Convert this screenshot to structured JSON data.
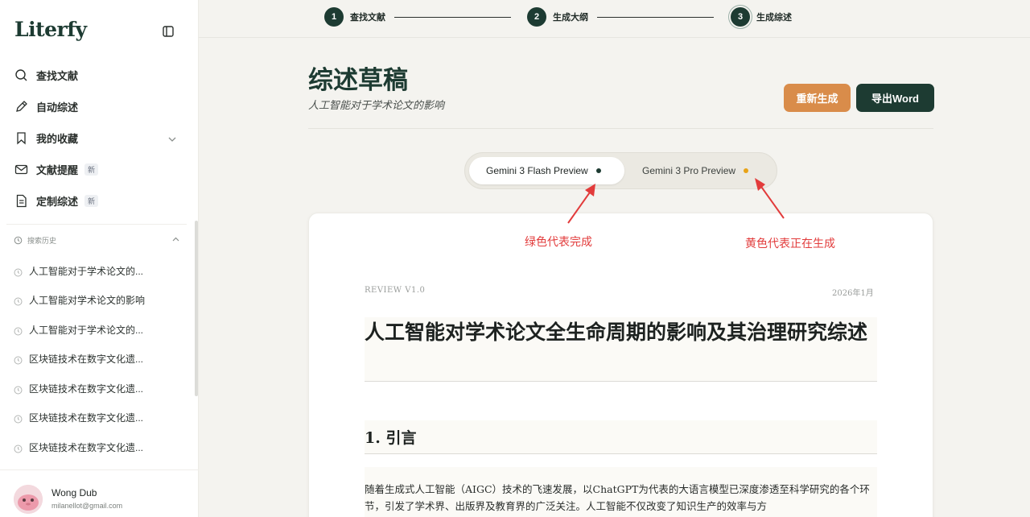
{
  "brand": "Literfy",
  "sidebar": {
    "nav": [
      {
        "label": "查找文献",
        "icon": "search-icon"
      },
      {
        "label": "自动综述",
        "icon": "pen-icon"
      },
      {
        "label": "我的收藏",
        "icon": "bookmark-icon"
      },
      {
        "label": "文献提醒",
        "icon": "mail-icon",
        "badge": "新"
      },
      {
        "label": "定制综述",
        "icon": "document-icon",
        "badge": "新"
      }
    ],
    "history_title": "搜索历史",
    "history": [
      "人工智能对于学术论文的...",
      "人工智能对学术论文的影响",
      "人工智能对于学术论文的...",
      "区块链技术在数字文化遗...",
      "区块链技术在数字文化遗...",
      "区块链技术在数字文化遗...",
      "区块链技术在数字文化遗..."
    ],
    "user": {
      "name": "Wong Dub",
      "email": "milanellot@gmail.com"
    }
  },
  "stepper": [
    {
      "num": "1",
      "label": "查找文献"
    },
    {
      "num": "2",
      "label": "生成大纲"
    },
    {
      "num": "3",
      "label": "生成综述"
    }
  ],
  "header": {
    "title": "综述草稿",
    "subtitle": "人工智能对于学术论文的影响",
    "regen_label": "重新生成",
    "export_label": "导出Word"
  },
  "models": [
    {
      "label": "Gemini 3 Flash Preview",
      "status_color": "#1d3b32"
    },
    {
      "label": "Gemini 3 Pro Preview",
      "status_color": "#e8a317"
    }
  ],
  "annotations": {
    "green": "绿色代表完成",
    "yellow": "黄色代表正在生成"
  },
  "doc": {
    "version": "REVIEW V1.0",
    "date": "2026年1月",
    "title": "人工智能对学术论文全生命周期的影响及其治理研究综述",
    "section1": "1. 引言",
    "para1": "随着生成式人工智能（AIGC）技术的飞速发展，以ChatGPT为代表的大语言模型已深度渗透至科学研究的各个环节，引发了学术界、出版界及教育界的广泛关注。人工智能不仅改变了知识生产的效率与方"
  },
  "colors": {
    "primary": "#1d3b32",
    "accent": "#d98c4a",
    "annotation": "#e23b3b"
  }
}
